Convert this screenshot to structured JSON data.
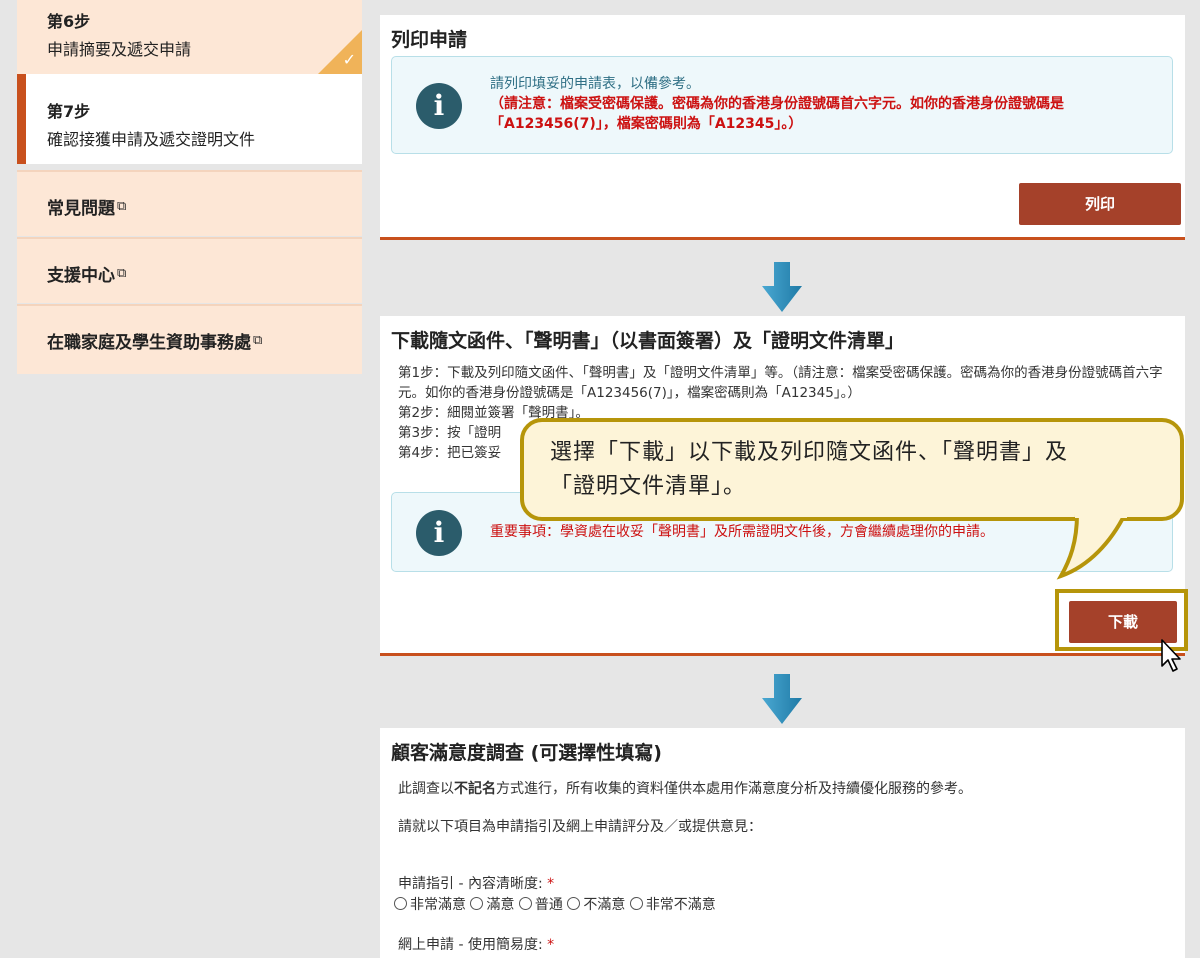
{
  "sidebar": {
    "step6": {
      "num": "第6步",
      "desc": "申請摘要及遞交申請",
      "check": "✓"
    },
    "step7": {
      "num": "第7步",
      "desc": "確認接獲申請及遞交證明文件"
    },
    "links": [
      {
        "label": "常見問題",
        "ext": "⧉"
      },
      {
        "label": "支援中心",
        "ext": "⧉"
      },
      {
        "label": "在職家庭及學生資助事務處",
        "ext": "⧉"
      }
    ]
  },
  "print_card": {
    "title": "列印申請",
    "info_line1": "請列印填妥的申請表，以備參考。",
    "info_line2": "（請注意：檔案受密碼保護。密碼為你的香港身份證號碼首六字元。如你的香港身份證號碼是「A123456(7)」，檔案密碼則為「A12345」。）",
    "button": "列印"
  },
  "download_card": {
    "title": "下載隨文函件、「聲明書」（以書面簽署）及「證明文件清單」",
    "step1": "第1步：下載及列印隨文函件、「聲明書」及「證明文件清單」等。（請注意：檔案受密碼保護。密碼為你的香港身份證號碼首六字元。如你的香港身份證號碼是「A123456(7)」，檔案密碼則為「A12345」。）",
    "step2": "第2步：細閱並簽署「聲明書」。",
    "step3": "第3步：按「證明",
    "step4": "第4步：把已簽妥",
    "notice": "重要事項：學資處在收妥「聲明書」及所需證明文件後，方會繼續處理你的申請。",
    "button": "下載"
  },
  "survey_card": {
    "title": "顧客滿意度調查 (可選擇性填寫)",
    "intro_pre": "此調查以",
    "intro_bold": "不記名",
    "intro_post": "方式進行，所有收集的資料僅供本處用作滿意度分析及持續優化服務的參考。",
    "instruction": "請就以下項目為申請指引及網上申請評分及／或提供意見：",
    "q1": "申請指引 - 內容清晰度:",
    "q1_required": "*",
    "options": [
      "非常滿意",
      "滿意",
      "普通",
      "不滿意",
      "非常不滿意"
    ],
    "q2": "網上申請 - 使用簡易度:",
    "q2_required": "*"
  },
  "callout": {
    "line1": "選擇「下載」以下載及列印隨文函件、「聲明書」及",
    "line2": "「證明文件清單」。"
  },
  "colors": {
    "accent": "#a5412a",
    "sidebar_bg": "#fde7d6",
    "info_bg": "#eef8fb",
    "arrow": "#2b8ab5",
    "callout_border": "#b6950a"
  }
}
